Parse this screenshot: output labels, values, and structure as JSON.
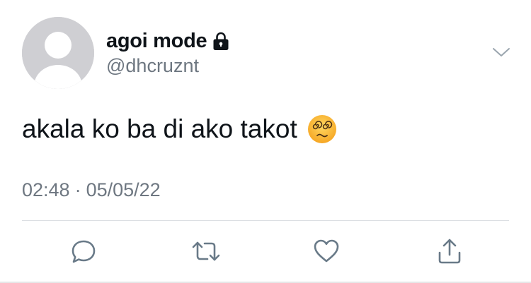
{
  "tweet": {
    "author": {
      "display_name": "agoi mode",
      "handle": "@dhcruznt",
      "protected_icon": "lock-icon",
      "avatar": "default-avatar"
    },
    "text": "akala ko ba di ako takot",
    "emoji": "face-with-spiral-eyes",
    "time": "02:48",
    "separator": "·",
    "date": "05/05/22"
  },
  "menu": {
    "icon": "chevron-down-icon"
  },
  "actions": [
    {
      "name": "reply",
      "icon": "speech-bubble-icon"
    },
    {
      "name": "retweet",
      "icon": "retweet-icon"
    },
    {
      "name": "like",
      "icon": "heart-icon"
    },
    {
      "name": "share",
      "icon": "share-icon"
    }
  ],
  "colors": {
    "text_primary": "#0f1419",
    "text_secondary": "#6e7781",
    "avatar_bg": "#cfcfd3",
    "icon_gray": "#697a88",
    "divider": "#dcdfe3"
  }
}
